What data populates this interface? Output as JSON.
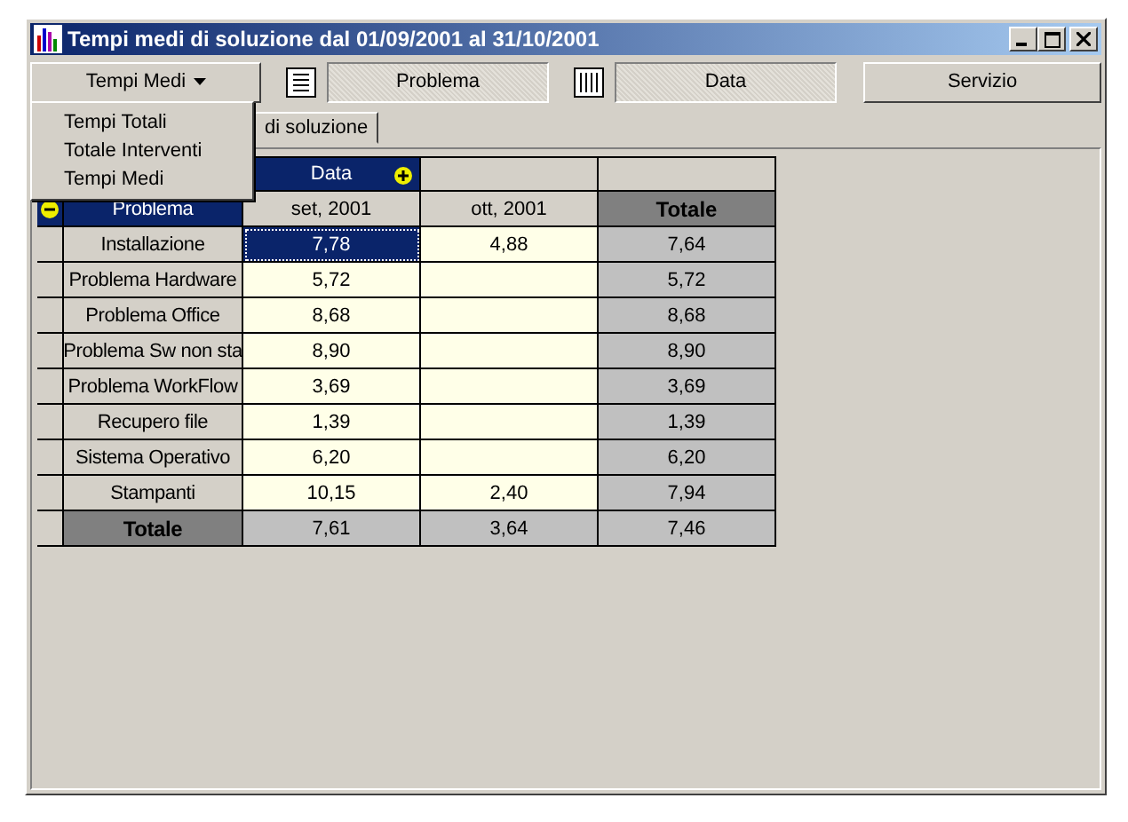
{
  "window": {
    "title": "Tempi medi di soluzione dal 01/09/2001 al 31/10/2001"
  },
  "toolbar": {
    "measure_button": "Tempi Medi",
    "row_field": "Problema",
    "column_field": "Data",
    "filter_button": "Servizio"
  },
  "measure_menu": {
    "items": [
      {
        "label": "Tempi Totali"
      },
      {
        "label": "Totale Interventi"
      },
      {
        "label": "Tempi Medi"
      }
    ]
  },
  "tabs": [
    {
      "label": "di soluzione"
    }
  ],
  "grid": {
    "column_dimension": "Data",
    "row_dimension": "Problema",
    "columns": [
      "set, 2001",
      "ott, 2001"
    ],
    "total_label": "Totale",
    "rows": [
      {
        "label": "Installazione",
        "cells": [
          {
            "text": "7,78",
            "selected": true
          },
          {
            "text": "4,88",
            "selected": false
          }
        ],
        "total": "7,64"
      },
      {
        "label": "Problema Hardware",
        "cells": [
          {
            "text": "5,72",
            "selected": false
          },
          {
            "selected": false
          }
        ],
        "total": "5,72"
      },
      {
        "label": "Problema Office",
        "cells": [
          {
            "text": "8,68",
            "selected": false
          },
          {
            "selected": false
          }
        ],
        "total": "8,68"
      },
      {
        "label": "Problema Sw non sta",
        "cells": [
          {
            "text": "8,90",
            "selected": false
          },
          {
            "selected": false
          }
        ],
        "total": "8,90"
      },
      {
        "label": "Problema WorkFlow",
        "cells": [
          {
            "text": "3,69",
            "selected": false
          },
          {
            "selected": false
          }
        ],
        "total": "3,69"
      },
      {
        "label": "Recupero file",
        "cells": [
          {
            "text": "1,39",
            "selected": false
          },
          {
            "selected": false
          }
        ],
        "total": "1,39"
      },
      {
        "label": "Sistema Operativo",
        "cells": [
          {
            "text": "6,20",
            "selected": false
          },
          {
            "selected": false
          }
        ],
        "total": "6,20"
      },
      {
        "label": "Stampanti",
        "cells": [
          {
            "text": "10,15",
            "selected": false
          },
          {
            "text": "2,40",
            "selected": false
          }
        ],
        "total": "7,94"
      }
    ],
    "totals_row": {
      "label": "Totale",
      "cells": [
        "7,61",
        "3,64"
      ],
      "total": "7,46"
    }
  }
}
